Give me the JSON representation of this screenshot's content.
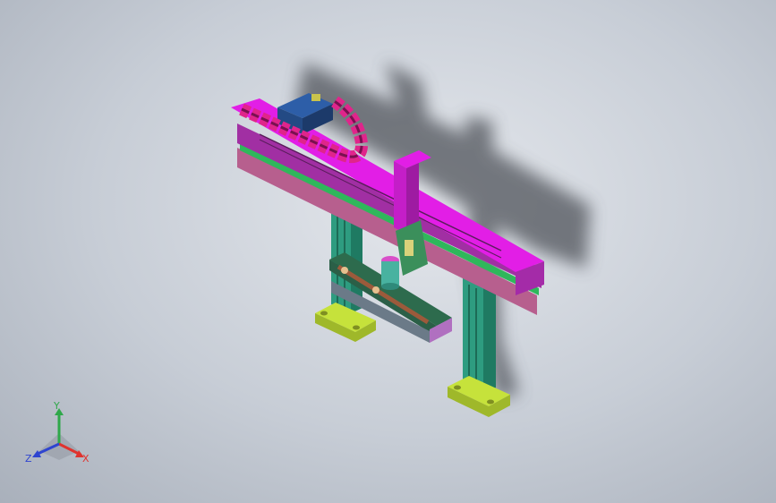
{
  "view": {
    "background_top": "#e4e7ec",
    "background_bottom": "#a9b0bb"
  },
  "model": {
    "colors": {
      "beam_top": "#e21ee6",
      "beam_side": "#a12fa3",
      "beam_plate": "#b75f8e",
      "rail_green": "#2fb75b",
      "drag_chain": "#e0258b",
      "motor_blue": "#2d5ea8",
      "column": "#2e9c80",
      "base_plate": "#c6e23b",
      "slide_plate": "#2d6b4d",
      "belt_brown": "#9c5a3b",
      "motor_head": "#d84fc9",
      "motor_body": "#48b2a0",
      "shadow": "#4f535a"
    }
  },
  "triad": {
    "y_label": "Y",
    "x_label": "X",
    "z_label": "Z",
    "y_color": "#2fa84a",
    "x_color": "#e0332e",
    "z_color": "#2e44d0"
  }
}
